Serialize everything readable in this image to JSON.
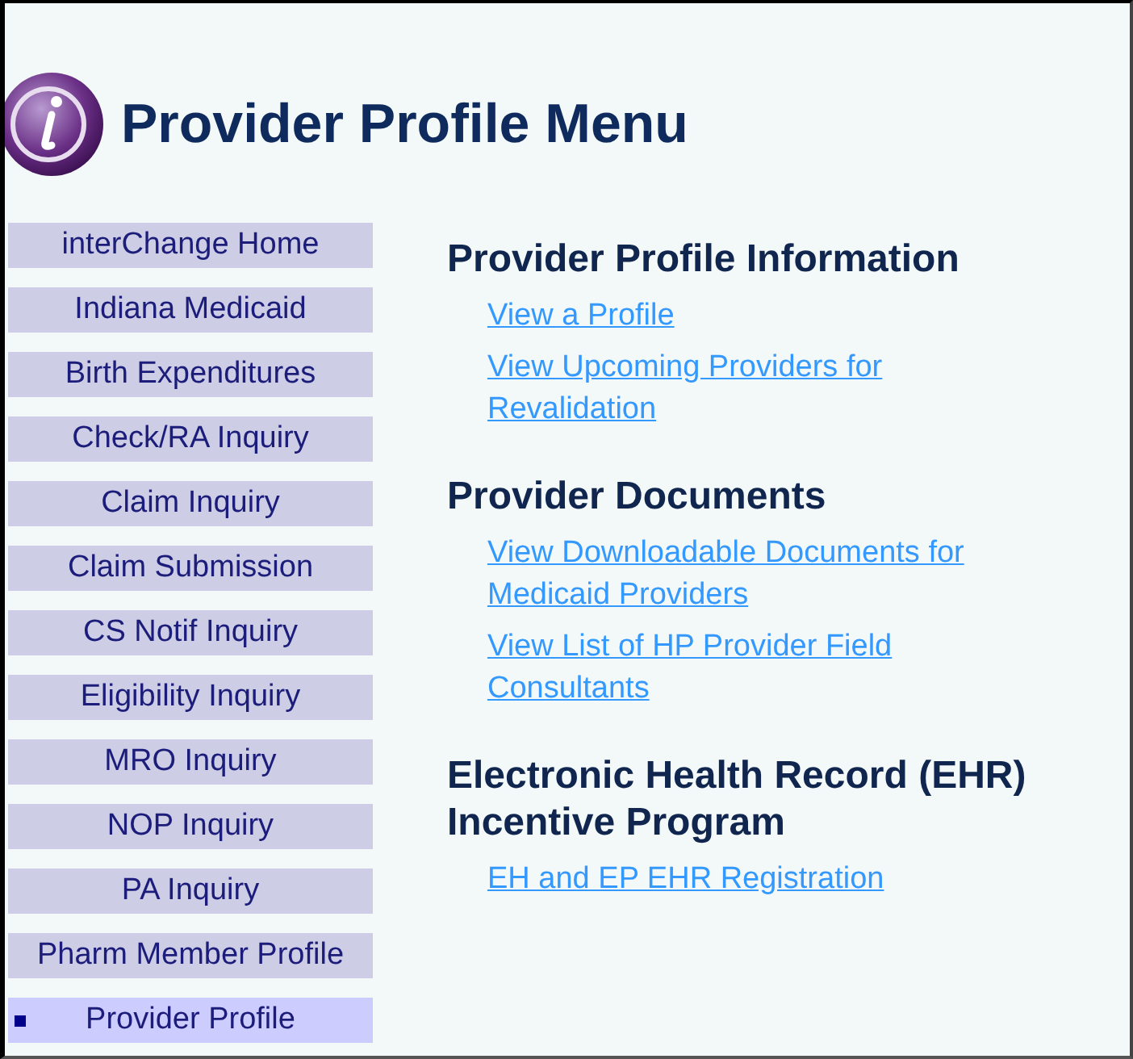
{
  "header": {
    "title": "Provider Profile Menu"
  },
  "sidebar": {
    "items": [
      {
        "label": "interChange Home",
        "selected": false
      },
      {
        "label": "Indiana Medicaid",
        "selected": false
      },
      {
        "label": "Birth Expenditures",
        "selected": false
      },
      {
        "label": "Check/RA Inquiry",
        "selected": false
      },
      {
        "label": "Claim Inquiry",
        "selected": false
      },
      {
        "label": "Claim Submission",
        "selected": false
      },
      {
        "label": "CS Notif Inquiry",
        "selected": false
      },
      {
        "label": "Eligibility Inquiry",
        "selected": false
      },
      {
        "label": "MRO Inquiry",
        "selected": false
      },
      {
        "label": "NOP Inquiry",
        "selected": false
      },
      {
        "label": "PA Inquiry",
        "selected": false
      },
      {
        "label": "Pharm Member Profile",
        "selected": false
      },
      {
        "label": "Provider Profile",
        "selected": true
      }
    ]
  },
  "sections": [
    {
      "heading": "Provider Profile Information",
      "links": [
        "View a Profile",
        "View Upcoming Providers for Revalidation"
      ]
    },
    {
      "heading": "Provider Documents",
      "links": [
        "View Downloadable Documents for Medicaid Providers",
        "View List of HP Provider Field Consultants"
      ]
    },
    {
      "heading": "Electronic Health Record (EHR) Incentive Program",
      "links": [
        "EH and EP EHR Registration"
      ]
    }
  ]
}
